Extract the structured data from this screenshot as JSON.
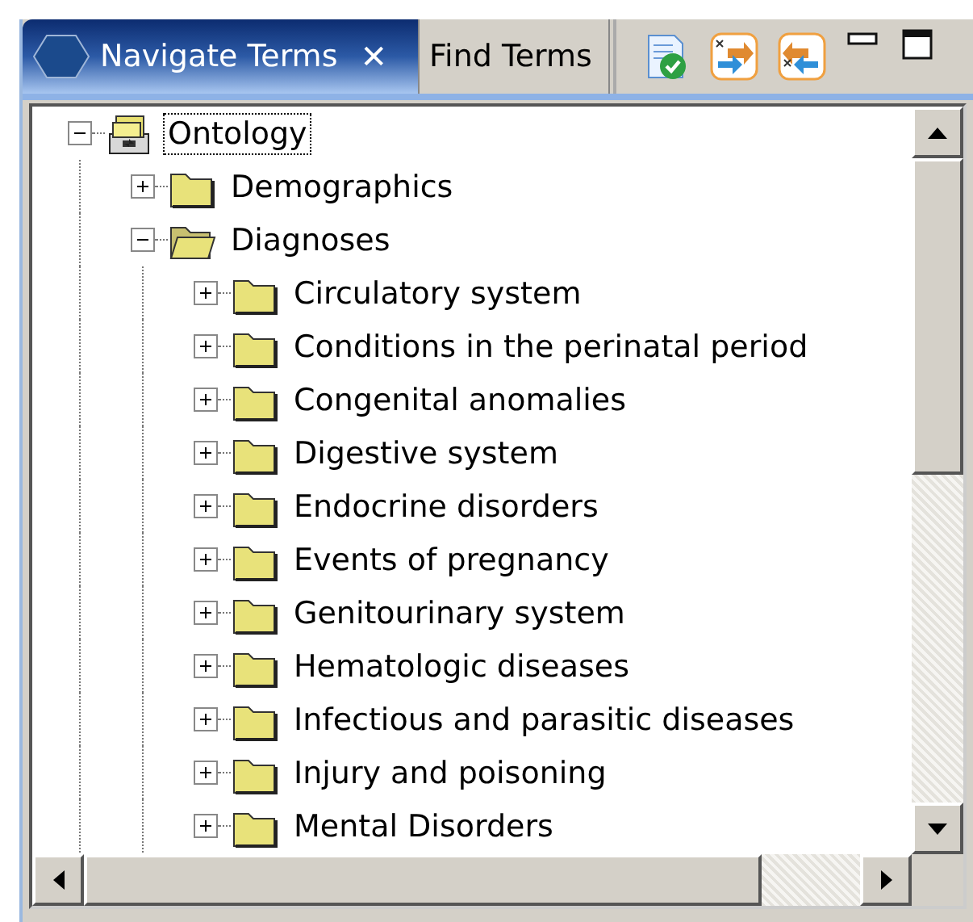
{
  "tabs": [
    {
      "label": "Navigate Terms",
      "selected": true,
      "closable": true,
      "close_glyph": "✕"
    },
    {
      "label": "Find Terms",
      "selected": false,
      "closable": false
    }
  ],
  "tree": [
    {
      "label": "Ontology",
      "kind": "root",
      "expanded": true,
      "focused": true,
      "children": [
        {
          "label": "Demographics",
          "kind": "folder",
          "expanded": false,
          "focused": false
        },
        {
          "label": "Diagnoses",
          "kind": "folder",
          "expanded": true,
          "focused": false,
          "children": [
            {
              "label": "Circulatory system",
              "kind": "folder",
              "expanded": false,
              "focused": false
            },
            {
              "label": "Conditions in the perinatal period",
              "kind": "folder",
              "expanded": false,
              "focused": false
            },
            {
              "label": "Congenital anomalies",
              "kind": "folder",
              "expanded": false,
              "focused": false
            },
            {
              "label": "Digestive system",
              "kind": "folder",
              "expanded": false,
              "focused": false
            },
            {
              "label": "Endocrine disorders",
              "kind": "folder",
              "expanded": false,
              "focused": false
            },
            {
              "label": "Events of pregnancy",
              "kind": "folder",
              "expanded": false,
              "focused": false
            },
            {
              "label": "Genitourinary system",
              "kind": "folder",
              "expanded": false,
              "focused": false
            },
            {
              "label": "Hematologic diseases",
              "kind": "folder",
              "expanded": false,
              "focused": false
            },
            {
              "label": "Infectious and parasitic diseases",
              "kind": "folder",
              "expanded": false,
              "focused": false
            },
            {
              "label": "Injury and poisoning",
              "kind": "folder",
              "expanded": false,
              "focused": false
            },
            {
              "label": "Mental Disorders",
              "kind": "folder",
              "expanded": false,
              "focused": false
            }
          ]
        }
      ]
    }
  ]
}
